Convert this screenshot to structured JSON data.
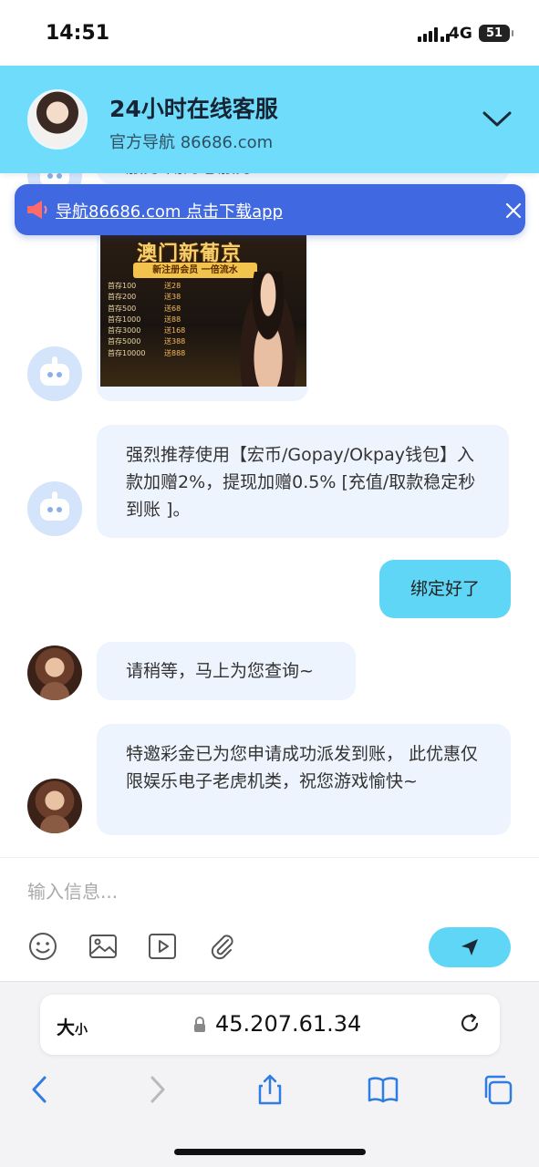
{
  "status_bar": {
    "time": "14:51",
    "network": "4G",
    "battery": "51"
  },
  "header": {
    "title": "24小时在线客服",
    "subtitle": "官方导航 86686.com",
    "collapse_icon": "chevron-down-icon"
  },
  "banner": {
    "text": "导航86686.com 点击下载app",
    "icon": "megaphone-icon",
    "close_icon": "close-icon"
  },
  "chat": {
    "partial_text": "服务 副刀总服务",
    "promo_image": {
      "title": "澳门新葡京",
      "subtitle": "新注册会员 一倍流水",
      "rows": [
        {
          "deposit": "首存100",
          "bonus": "送28"
        },
        {
          "deposit": "首存200",
          "bonus": "送38"
        },
        {
          "deposit": "首存500",
          "bonus": "送68"
        },
        {
          "deposit": "首存1000",
          "bonus": "送88"
        },
        {
          "deposit": "首存3000",
          "bonus": "送168"
        },
        {
          "deposit": "首存5000",
          "bonus": "送388"
        },
        {
          "deposit": "首存10000",
          "bonus": "送888"
        }
      ]
    },
    "messages": [
      {
        "from": "bot",
        "text": "强烈推荐使用【宏币/Gopay/Okpay钱包】入款加赠2%，提现加赠0.5% [充值/取款稳定秒到账 ]。"
      },
      {
        "from": "me",
        "text": "绑定好了"
      },
      {
        "from": "agent",
        "text": "请稍等，马上为您查询~"
      },
      {
        "from": "agent",
        "text": "特邀彩金已为您申请成功派发到账， 此优惠仅限娱乐电子老虎机类，祝您游戏愉快~"
      }
    ]
  },
  "composer": {
    "placeholder": "输入信息...",
    "tools": [
      "emoji-icon",
      "image-icon",
      "video-icon",
      "attachment-icon"
    ],
    "send_icon": "send-icon"
  },
  "browser": {
    "size_label": "大",
    "size_label_small": "小",
    "url": "45.207.61.34",
    "nav_icons": [
      "back-icon",
      "forward-icon",
      "share-icon",
      "bookmarks-icon",
      "tabs-icon"
    ]
  }
}
